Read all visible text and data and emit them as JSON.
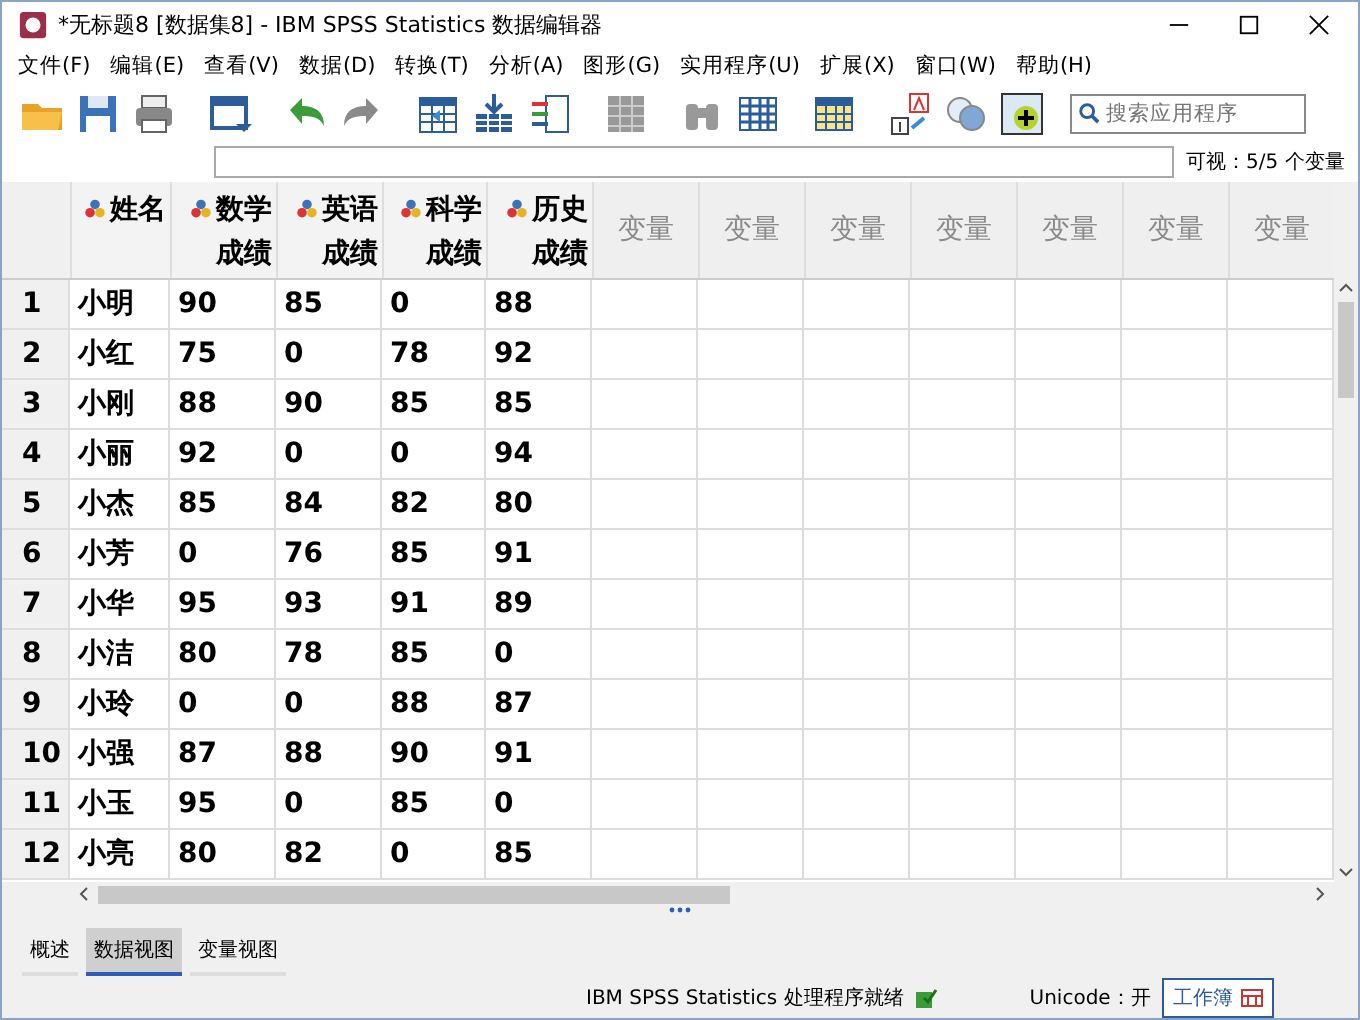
{
  "window": {
    "title": "*无标题8 [数据集8] - IBM SPSS Statistics 数据编辑器"
  },
  "menu": [
    "文件(F)",
    "编辑(E)",
    "查看(V)",
    "数据(D)",
    "转换(T)",
    "分析(A)",
    "图形(G)",
    "实用程序(U)",
    "扩展(X)",
    "窗口(W)",
    "帮助(H)"
  ],
  "search": {
    "placeholder": "搜索应用程序"
  },
  "visible_count": "可视：5/5 个变量",
  "columns": [
    {
      "label": "姓名",
      "defined": true
    },
    {
      "label": "数学成绩",
      "defined": true
    },
    {
      "label": "英语成绩",
      "defined": true
    },
    {
      "label": "科学成绩",
      "defined": true
    },
    {
      "label": "历史成绩",
      "defined": true
    },
    {
      "label": "变量",
      "defined": false
    },
    {
      "label": "变量",
      "defined": false
    },
    {
      "label": "变量",
      "defined": false
    },
    {
      "label": "变量",
      "defined": false
    },
    {
      "label": "变量",
      "defined": false
    },
    {
      "label": "变量",
      "defined": false
    },
    {
      "label": "变量",
      "defined": false
    }
  ],
  "rows": [
    {
      "number": "1",
      "cells": [
        "小明",
        "90",
        "85",
        "0",
        "88"
      ]
    },
    {
      "number": "2",
      "cells": [
        "小红",
        "75",
        "0",
        "78",
        "92"
      ]
    },
    {
      "number": "3",
      "cells": [
        "小刚",
        "88",
        "90",
        "85",
        "85"
      ]
    },
    {
      "number": "4",
      "cells": [
        "小丽",
        "92",
        "0",
        "0",
        "94"
      ]
    },
    {
      "number": "5",
      "cells": [
        "小杰",
        "85",
        "84",
        "82",
        "80"
      ]
    },
    {
      "number": "6",
      "cells": [
        "小芳",
        "0",
        "76",
        "85",
        "91"
      ]
    },
    {
      "number": "7",
      "cells": [
        "小华",
        "95",
        "93",
        "91",
        "89"
      ]
    },
    {
      "number": "8",
      "cells": [
        "小洁",
        "80",
        "78",
        "85",
        "0"
      ]
    },
    {
      "number": "9",
      "cells": [
        "小玲",
        "0",
        "0",
        "88",
        "87"
      ]
    },
    {
      "number": "10",
      "cells": [
        "小强",
        "87",
        "88",
        "90",
        "91"
      ]
    },
    {
      "number": "11",
      "cells": [
        "小玉",
        "95",
        "0",
        "85",
        "0"
      ]
    },
    {
      "number": "12",
      "cells": [
        "小亮",
        "80",
        "82",
        "0",
        "85"
      ]
    }
  ],
  "tabs": [
    {
      "label": "概述",
      "selected": false
    },
    {
      "label": "数据视图",
      "selected": true
    },
    {
      "label": "变量视图",
      "selected": false
    }
  ],
  "status_bar": {
    "processor": "IBM SPSS Statistics 处理程序就绪",
    "unicode": "Unicode：开",
    "workbook_button": "工作簿"
  }
}
